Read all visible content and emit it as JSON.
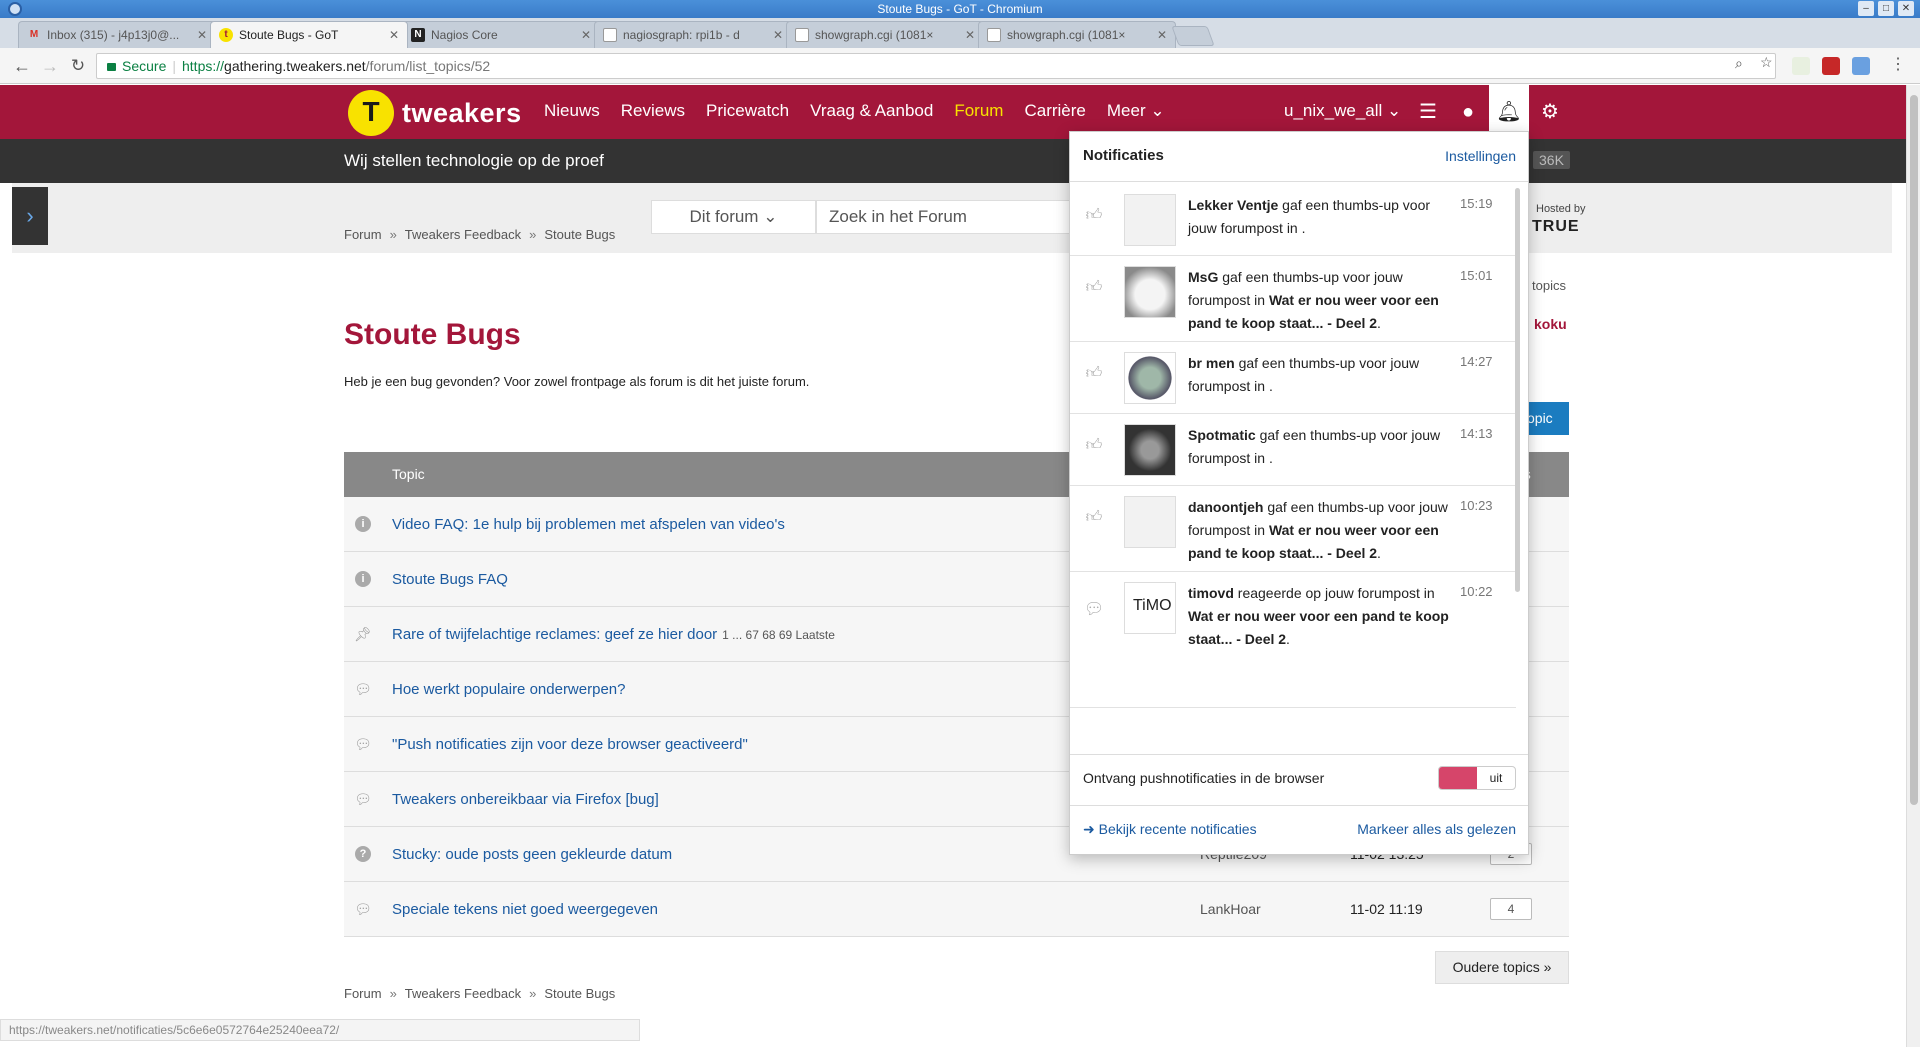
{
  "window": {
    "title": "Stoute Bugs - GoT - Chromium",
    "controls": [
      "–",
      "□",
      "✕"
    ]
  },
  "tabs": [
    {
      "label": "Inbox (315) - j4p13j0@...",
      "icon": "gmail-icon"
    },
    {
      "label": "Stoute Bugs - GoT",
      "icon": "tweakers-icon"
    },
    {
      "label": "Nagios Core",
      "icon": "nagios-icon"
    },
    {
      "label": "nagiosgraph: rpi1b - d",
      "icon": "page-icon"
    },
    {
      "label": "showgraph.cgi (1081×",
      "icon": "page-icon"
    },
    {
      "label": "showgraph.cgi (1081×",
      "icon": "page-icon"
    }
  ],
  "address": {
    "secure_label": "Secure",
    "scheme": "https://",
    "host": "gathering.tweakers.net",
    "path": "/forum/list_topics/52"
  },
  "site": {
    "brand": "tweakers",
    "nav": [
      "Nieuws",
      "Reviews",
      "Pricewatch",
      "Vraag & Aanbod",
      "Forum",
      "Carrière",
      "Meer"
    ],
    "username": "u_nix_we_all",
    "tagline": "Wij stellen technologie op de proef",
    "tag_count": "36K"
  },
  "search": {
    "forum_select": "Dit forum",
    "placeholder": "Zoek in het Forum",
    "hosted_by": "Hosted by",
    "hosted_logo": "TRUE"
  },
  "breadcrumb": [
    "Forum",
    "Tweakers Feedback",
    "Stoute Bugs"
  ],
  "page": {
    "title": "Stoute Bugs",
    "description": "Heb je een bug gevonden? Voor zowel frontpage als forum is dit het juiste forum.",
    "new_topic": "opic",
    "right_link": "topics",
    "right_user": "koku",
    "older_topics": "Oudere topics »",
    "status_url": "https://tweakers.net/notificaties/5c6e6e0572764e25240eea72/"
  },
  "table": {
    "headers": {
      "topic": "Topic",
      "replies": "es"
    },
    "rows": [
      {
        "icon": "info-icon",
        "title": "Video FAQ: 1e hulp bij problemen met afspelen van video's",
        "pages": "",
        "author": "",
        "date": "",
        "count": ""
      },
      {
        "icon": "info-icon",
        "title": "Stoute Bugs FAQ",
        "pages": "",
        "author": "",
        "date": "",
        "count": ""
      },
      {
        "icon": "pin-icon",
        "title": "Rare of twijfelachtige reclames: geef ze hier door",
        "pages": "1 ... 67 68 69 Laatste",
        "author": "",
        "date": "",
        "count": ""
      },
      {
        "icon": "chat-icon",
        "title": "Hoe werkt populaire onderwerpen?",
        "pages": "",
        "author": "",
        "date": "",
        "count": ""
      },
      {
        "icon": "chat-icon",
        "title": "\"Push notificaties zijn voor deze browser geactiveerd\"",
        "pages": "",
        "author": "",
        "date": "",
        "count": ""
      },
      {
        "icon": "chat-icon",
        "title": "Tweakers onbereikbaar via Firefox [bug]",
        "pages": "",
        "author": "",
        "date": "",
        "count": ""
      },
      {
        "icon": "question-icon",
        "title": "Stucky: oude posts geen gekleurde datum",
        "pages": "",
        "author": "Reptile209",
        "date": "11-02 13:25",
        "count": "2"
      },
      {
        "icon": "chat-icon",
        "title": "Speciale tekens niet goed weergegeven",
        "pages": "",
        "author": "LankHoar",
        "date": "11-02 11:19",
        "count": "4"
      }
    ]
  },
  "notifications": {
    "title": "Notificaties",
    "settings": "Instellingen",
    "items": [
      {
        "icon": "thumbs-up-icon",
        "user": "Lekker Ventje",
        "action": "gaf een thumbs-up voor jouw forumpost in",
        "target": "",
        "time": "15:19",
        "avatar": "avatar-blank"
      },
      {
        "icon": "thumbs-up-icon",
        "user": "MsG",
        "action": "gaf een thumbs-up voor jouw forumpost in",
        "target": "Wat er nou weer voor een pand te koop staat... - Deel 2",
        "time": "15:01",
        "avatar": "avatar-cat-white"
      },
      {
        "icon": "thumbs-up-icon",
        "user": "br men",
        "action": "gaf een thumbs-up voor jouw forumpost in",
        "target": "",
        "time": "14:27",
        "avatar": "avatar-cat-cartoon"
      },
      {
        "icon": "thumbs-up-icon",
        "user": "Spotmatic",
        "action": "gaf een thumbs-up voor jouw forumpost in",
        "target": "",
        "time": "14:13",
        "avatar": "avatar-car-logo"
      },
      {
        "icon": "thumbs-up-icon",
        "user": "danoontjeh",
        "action": "gaf een thumbs-up voor jouw forumpost in",
        "target": "Wat er nou weer voor een pand te koop staat... - Deel 2",
        "time": "10:23",
        "avatar": "avatar-blank"
      },
      {
        "icon": "chat-icon",
        "user": "timovd",
        "action": "reageerde op jouw forumpost in",
        "target": "Wat er nou weer voor een pand te koop staat... - Deel 2",
        "time": "10:22",
        "avatar": "avatar-timo"
      }
    ],
    "push_label": "Ontvang pushnotificaties in de browser",
    "push_state": "uit",
    "recent_link": "Bekijk recente notificaties",
    "mark_all": "Markeer alles als gelezen"
  },
  "colors": {
    "brand": "#a3163a",
    "link": "#1b5aa0",
    "accent": "#f8e200"
  }
}
